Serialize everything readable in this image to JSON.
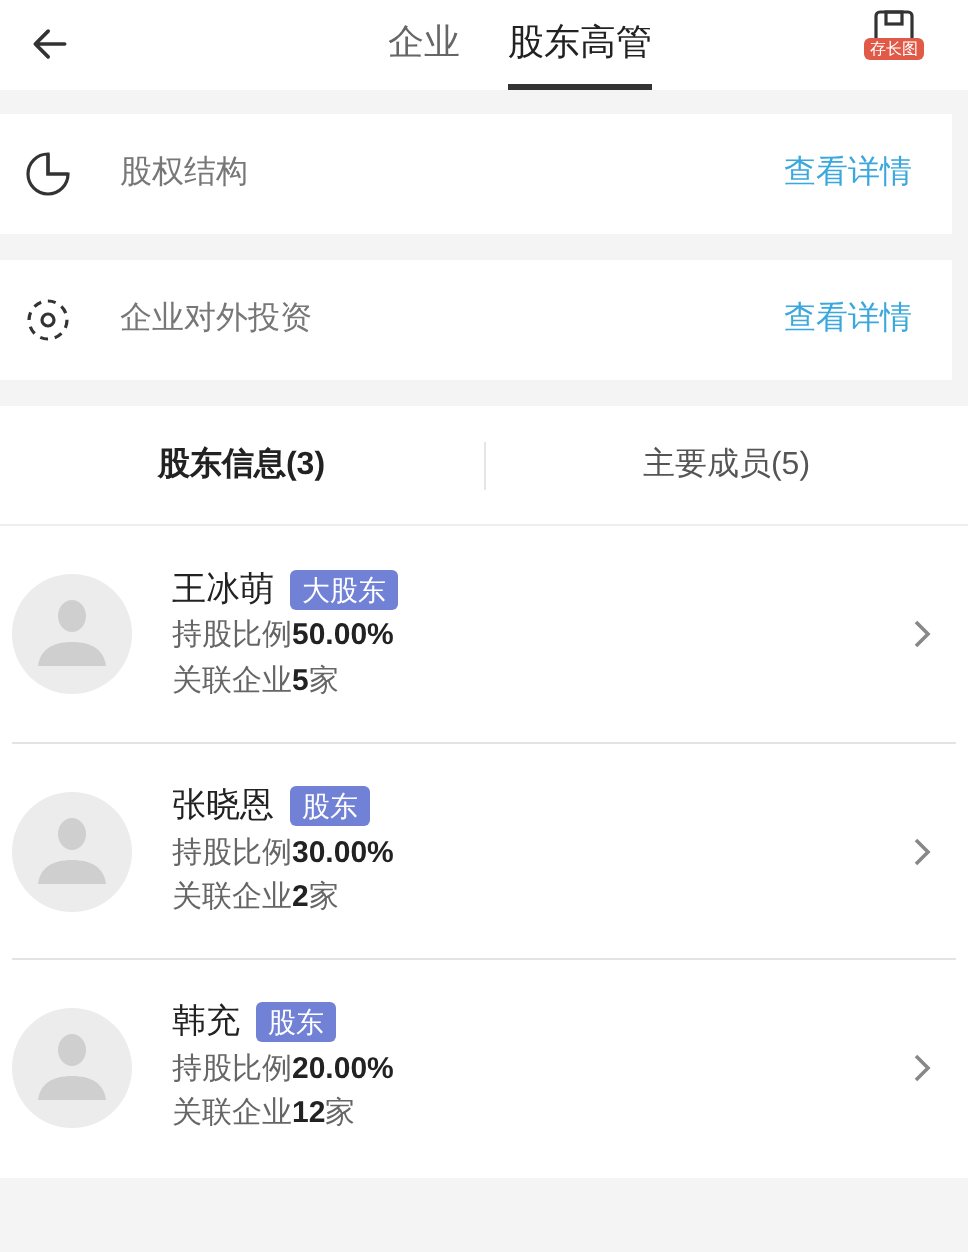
{
  "header": {
    "tabs": [
      {
        "label": "企业",
        "selected": false
      },
      {
        "label": "股东高管",
        "selected": true
      }
    ],
    "save_badge": "存长图"
  },
  "entries": [
    {
      "kind": "pie",
      "label": "股权结构",
      "link": "查看详情"
    },
    {
      "kind": "target",
      "label": "企业对外投资",
      "link": "查看详情"
    }
  ],
  "section_tabs": [
    {
      "label": "股东信息(3)",
      "selected": true
    },
    {
      "label": "主要成员(5)",
      "selected": false
    }
  ],
  "shareholders": [
    {
      "name": "王冰萌",
      "tag": "大股东",
      "ratio": "持股比例**50.00%**",
      "companies": "关联企业**5**家"
    },
    {
      "name": "张晓恩",
      "tag": "股东",
      "ratio": "持股比例**30.00%**",
      "companies": "关联企业**2**家"
    },
    {
      "name": "韩充",
      "tag": "股东",
      "ratio": "持股比例**20.00%**",
      "companies": "关联企业**12**家"
    }
  ]
}
